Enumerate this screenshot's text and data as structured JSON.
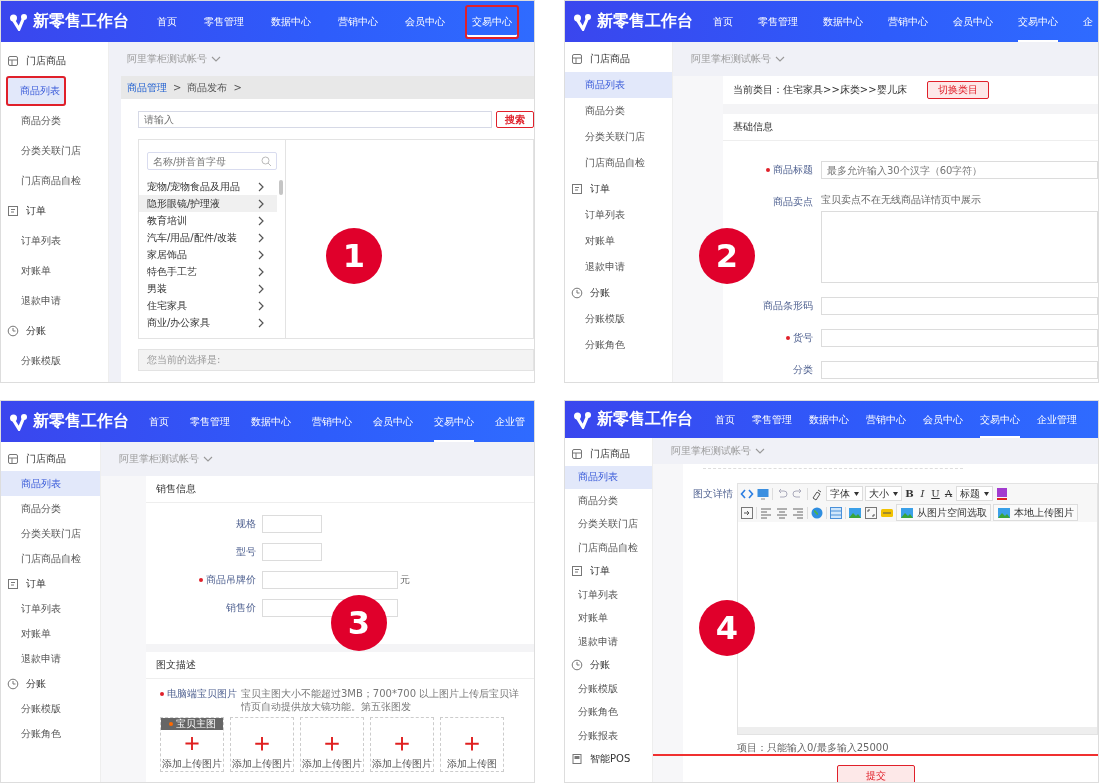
{
  "panels": [
    {
      "step": "1",
      "header": {
        "logo": "新零售工作台",
        "nav": [
          {
            "label": "首页",
            "selected": false,
            "highlighted": false
          },
          {
            "label": "零售管理",
            "selected": false,
            "highlighted": false
          },
          {
            "label": "数据中心",
            "selected": false,
            "highlighted": false
          },
          {
            "label": "营销中心",
            "selected": false,
            "highlighted": false
          },
          {
            "label": "会员中心",
            "selected": false,
            "highlighted": false
          },
          {
            "label": "交易中心",
            "selected": true,
            "highlighted": true
          }
        ]
      },
      "account": "阿里掌柜测试帐号",
      "sidebar": [
        {
          "kind": "store",
          "label": "门店商品",
          "children": [
            {
              "label": "商品列表",
              "selected": true,
              "highlighted": true
            },
            {
              "label": "商品分类",
              "selected": false,
              "highlighted": false
            },
            {
              "label": "分类关联门店",
              "selected": false,
              "highlighted": false
            },
            {
              "label": "门店商品自检",
              "selected": false,
              "highlighted": false
            }
          ]
        },
        {
          "kind": "order",
          "label": "订单",
          "children": [
            {
              "label": "订单列表",
              "selected": false,
              "highlighted": false
            },
            {
              "label": "对账单",
              "selected": false,
              "highlighted": false
            },
            {
              "label": "退款申请",
              "selected": false,
              "highlighted": false
            }
          ]
        },
        {
          "kind": "clock",
          "label": "分账",
          "children": [
            {
              "label": "分账模版",
              "selected": false,
              "highlighted": false
            }
          ]
        }
      ],
      "content": {
        "kind": "category-picker",
        "breadcrumb": [
          {
            "label": "商品管理",
            "link": true
          },
          {
            "label": "商品发布",
            "link": false
          }
        ],
        "separator": ">",
        "search": {
          "placeholder": "请输入",
          "button": "搜索"
        },
        "filter_placeholder": "名称/拼音首字母",
        "categories": [
          {
            "label": "宠物/宠物食品及用品",
            "selected": false
          },
          {
            "label": "隐形眼镜/护理液",
            "selected": true
          },
          {
            "label": "教育培训",
            "selected": false
          },
          {
            "label": "汽车/用品/配件/改装",
            "selected": false
          },
          {
            "label": "家居饰品",
            "selected": false
          },
          {
            "label": "特色手工艺",
            "selected": false
          },
          {
            "label": "男装",
            "selected": false
          },
          {
            "label": "住宅家具",
            "selected": false
          },
          {
            "label": "商业/办公家具",
            "selected": false
          }
        ],
        "choice_label": "您当前的选择是:"
      }
    },
    {
      "step": "2",
      "header": {
        "logo": "新零售工作台",
        "nav": [
          {
            "label": "首页",
            "selected": false,
            "highlighted": false
          },
          {
            "label": "零售管理",
            "selected": false,
            "highlighted": false
          },
          {
            "label": "数据中心",
            "selected": false,
            "highlighted": false
          },
          {
            "label": "营销中心",
            "selected": false,
            "highlighted": false
          },
          {
            "label": "会员中心",
            "selected": false,
            "highlighted": false
          },
          {
            "label": "交易中心",
            "selected": true,
            "highlighted": false
          },
          {
            "label": "企",
            "selected": false,
            "highlighted": false
          }
        ]
      },
      "account": "阿里掌柜测试帐号",
      "sidebar": [
        {
          "kind": "store",
          "label": "门店商品",
          "children": [
            {
              "label": "商品列表",
              "selected": true,
              "highlighted": false
            },
            {
              "label": "商品分类",
              "selected": false,
              "highlighted": false
            },
            {
              "label": "分类关联门店",
              "selected": false,
              "highlighted": false
            },
            {
              "label": "门店商品自检",
              "selected": false,
              "highlighted": false
            }
          ]
        },
        {
          "kind": "order",
          "label": "订单",
          "children": [
            {
              "label": "订单列表",
              "selected": false,
              "highlighted": false
            },
            {
              "label": "对账单",
              "selected": false,
              "highlighted": false
            },
            {
              "label": "退款申请",
              "selected": false,
              "highlighted": false
            }
          ]
        },
        {
          "kind": "clock",
          "label": "分账",
          "children": [
            {
              "label": "分账模版",
              "selected": false,
              "highlighted": false
            },
            {
              "label": "分账角色",
              "selected": false,
              "highlighted": false
            }
          ]
        }
      ],
      "content": {
        "kind": "basic-info",
        "current_category": "当前类目：住宅家具>>床类>>婴儿床",
        "switch_button": "切换类目",
        "section": "基础信息",
        "fields": [
          {
            "kind": "input",
            "label": "商品标题",
            "required": true,
            "placeholder": "最多允许输入30个汉字（60字符）"
          },
          {
            "kind": "textarea",
            "label": "商品卖点",
            "required": false,
            "hint": "宝贝卖点不在无线商品详情页中展示"
          },
          {
            "kind": "input",
            "label": "商品条形码",
            "required": false
          },
          {
            "kind": "input",
            "label": "货号",
            "required": true
          },
          {
            "kind": "input",
            "label": "分类",
            "required": false
          }
        ]
      }
    },
    {
      "step": "3",
      "header": {
        "logo": "新零售工作台",
        "nav": [
          {
            "label": "首页",
            "selected": false,
            "highlighted": false
          },
          {
            "label": "零售管理",
            "selected": false,
            "highlighted": false
          },
          {
            "label": "数据中心",
            "selected": false,
            "highlighted": false
          },
          {
            "label": "营销中心",
            "selected": false,
            "highlighted": false
          },
          {
            "label": "会员中心",
            "selected": false,
            "highlighted": false
          },
          {
            "label": "交易中心",
            "selected": true,
            "highlighted": false
          },
          {
            "label": "企业管",
            "selected": false,
            "highlighted": false
          }
        ]
      },
      "account": "阿里掌柜测试帐号",
      "sidebar": [
        {
          "kind": "store",
          "label": "门店商品",
          "children": [
            {
              "label": "商品列表",
              "selected": true,
              "highlighted": false
            },
            {
              "label": "商品分类",
              "selected": false,
              "highlighted": false
            },
            {
              "label": "分类关联门店",
              "selected": false,
              "highlighted": false
            },
            {
              "label": "门店商品自检",
              "selected": false,
              "highlighted": false
            }
          ]
        },
        {
          "kind": "order",
          "label": "订单",
          "children": [
            {
              "label": "订单列表",
              "selected": false,
              "highlighted": false
            },
            {
              "label": "对账单",
              "selected": false,
              "highlighted": false
            },
            {
              "label": "退款申请",
              "selected": false,
              "highlighted": false
            }
          ]
        },
        {
          "kind": "clock",
          "label": "分账",
          "children": [
            {
              "label": "分账模版",
              "selected": false,
              "highlighted": false
            },
            {
              "label": "分账角色",
              "selected": false,
              "highlighted": false
            }
          ]
        }
      ],
      "content": {
        "kind": "sales-info",
        "section": "销售信息",
        "fields": [
          {
            "kind": "short",
            "label": "规格",
            "required": false
          },
          {
            "kind": "short",
            "label": "型号",
            "required": false
          },
          {
            "kind": "medium",
            "label": "商品吊牌价",
            "required": true,
            "suffix": "元"
          },
          {
            "kind": "medium",
            "label": "销售价",
            "required": false
          }
        ],
        "section2": "图文描述",
        "images_label": "电脑端宝贝图片",
        "images_required": true,
        "images_hint": "宝贝主图大小不能超过3MB；700*700 以上图片上传后宝贝详情页自动提供放大镜功能。第五张图发",
        "tiles": [
          {
            "tag": "宝贝主图",
            "label": "添加上传图片"
          },
          {
            "label": "添加上传图片"
          },
          {
            "label": "添加上传图片"
          },
          {
            "label": "添加上传图片"
          },
          {
            "label": "添加上传图"
          }
        ]
      }
    },
    {
      "step": "4",
      "header": {
        "logo": "新零售工作台",
        "nav": [
          {
            "label": "首页",
            "selected": false,
            "highlighted": false
          },
          {
            "label": "零售管理",
            "selected": false,
            "highlighted": false
          },
          {
            "label": "数据中心",
            "selected": false,
            "highlighted": false
          },
          {
            "label": "营销中心",
            "selected": false,
            "highlighted": false
          },
          {
            "label": "会员中心",
            "selected": false,
            "highlighted": false
          },
          {
            "label": "交易中心",
            "selected": true,
            "highlighted": false
          },
          {
            "label": "企业管理",
            "selected": false,
            "highlighted": false
          }
        ]
      },
      "account": "阿里掌柜测试帐号",
      "sidebar": [
        {
          "kind": "store",
          "label": "门店商品",
          "children": [
            {
              "label": "商品列表",
              "selected": true,
              "highlighted": false
            },
            {
              "label": "商品分类",
              "selected": false,
              "highlighted": false
            },
            {
              "label": "分类关联门店",
              "selected": false,
              "highlighted": false
            },
            {
              "label": "门店商品自检",
              "selected": false,
              "highlighted": false
            }
          ]
        },
        {
          "kind": "order",
          "label": "订单",
          "children": [
            {
              "label": "订单列表",
              "selected": false,
              "highlighted": false
            },
            {
              "label": "对账单",
              "selected": false,
              "highlighted": false
            },
            {
              "label": "退款申请",
              "selected": false,
              "highlighted": false
            }
          ]
        },
        {
          "kind": "clock",
          "label": "分账",
          "children": [
            {
              "label": "分账模版",
              "selected": false,
              "highlighted": false
            },
            {
              "label": "分账角色",
              "selected": false,
              "highlighted": false
            },
            {
              "label": "分账报表",
              "selected": false,
              "highlighted": false
            }
          ]
        },
        {
          "kind": "pos",
          "label": "智能POS"
        }
      ],
      "content": {
        "kind": "editor",
        "label": "图文详情",
        "toolbar": [
          [
            {
              "kind": "icon"
            },
            {
              "kind": "icon"
            },
            {
              "kind": "separator"
            },
            {
              "kind": "icon"
            },
            {
              "kind": "icon"
            },
            {
              "kind": "separator"
            },
            {
              "kind": "icon"
            },
            {
              "kind": "select",
              "label": "字体"
            },
            {
              "kind": "select",
              "label": "大小"
            },
            {
              "kind": "bold",
              "label": "B"
            },
            {
              "kind": "italic",
              "label": "I"
            },
            {
              "kind": "underline",
              "label": "U"
            },
            {
              "kind": "strike",
              "label": "A"
            },
            {
              "kind": "select",
              "label": "标题"
            },
            {
              "kind": "icon"
            }
          ],
          [
            {
              "kind": "icon"
            },
            {
              "kind": "separator"
            },
            {
              "kind": "icon"
            },
            {
              "kind": "icon"
            },
            {
              "kind": "icon"
            },
            {
              "kind": "separator"
            },
            {
              "kind": "icon"
            },
            {
              "kind": "separator"
            },
            {
              "kind": "icon"
            },
            {
              "kind": "separator"
            },
            {
              "kind": "icon"
            },
            {
              "kind": "icon"
            },
            {
              "kind": "icon"
            },
            {
              "kind": "image-button",
              "label": "从图片空间选取"
            },
            {
              "kind": "image-button",
              "label": "本地上传图片"
            }
          ]
        ],
        "note": "项目：只能输入0/最多输入25000",
        "submit": "提交"
      }
    }
  ]
}
